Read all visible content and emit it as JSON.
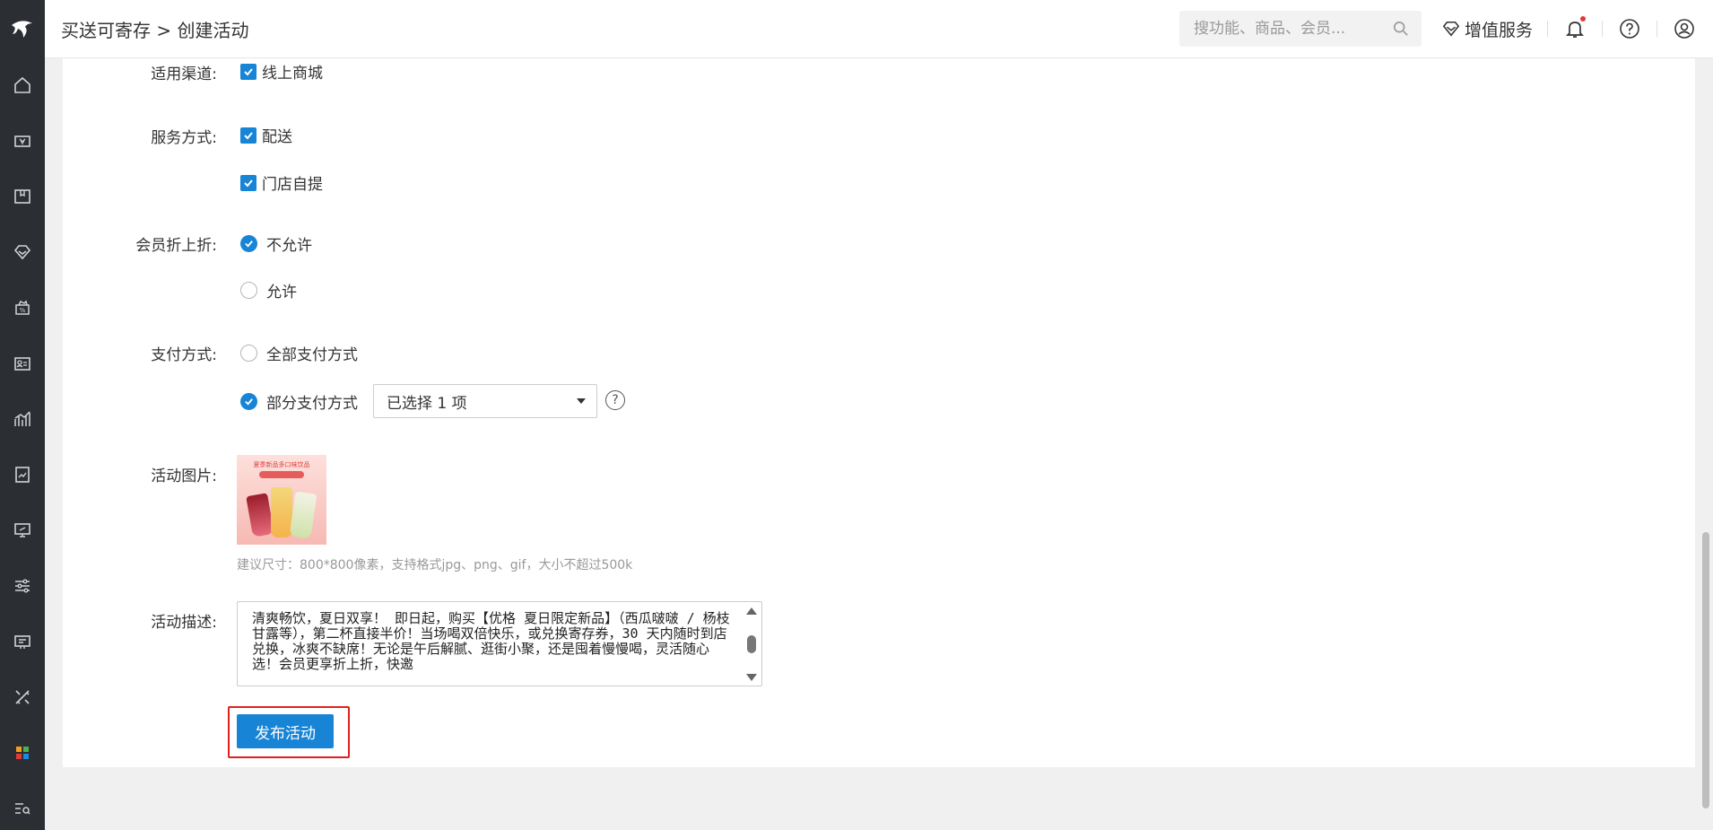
{
  "header": {
    "breadcrumb": "买送可寄存 > 创建活动",
    "search_placeholder": "搜功能、商品、会员...",
    "value_added": "增值服务"
  },
  "form": {
    "channel": {
      "label": "适用渠道:",
      "options": [
        {
          "label": "线上商城",
          "checked": true
        }
      ]
    },
    "service": {
      "label": "服务方式:",
      "options": [
        {
          "label": "配送",
          "checked": true
        },
        {
          "label": "门店自提",
          "checked": true
        }
      ]
    },
    "member_discount": {
      "label": "会员折上折:",
      "options": [
        {
          "label": "不允许",
          "selected": true
        },
        {
          "label": "允许",
          "selected": false
        }
      ]
    },
    "payment": {
      "label": "支付方式:",
      "options": [
        {
          "label": "全部支付方式",
          "selected": false
        },
        {
          "label": "部分支付方式",
          "selected": true
        }
      ],
      "select_value": "已选择 1 项",
      "help": "?"
    },
    "image": {
      "label": "活动图片:",
      "hint": "建议尺寸：800*800像素，支持格式jpg、png、gif，大小不超过500k",
      "poster_title": "夏季新品多口味饮品"
    },
    "description": {
      "label": "活动描述:",
      "value": "清爽畅饮，夏日双享！ 即日起，购买【优格 夏日限定新品】（西瓜啵啵 / 杨枝甘露等），第二杯直接半价！当场喝双倍快乐，或兑换寄存券，30 天内随时到店兑换，冰爽不缺席！无论是午后解腻、逛街小聚，还是囤着慢慢喝，灵活随心选！会员更享折上折，快邀"
    },
    "submit_label": "发布活动"
  },
  "colors": {
    "primary": "#1784d6",
    "highlight": "#e02020",
    "sidebar": "#2b2e33"
  }
}
